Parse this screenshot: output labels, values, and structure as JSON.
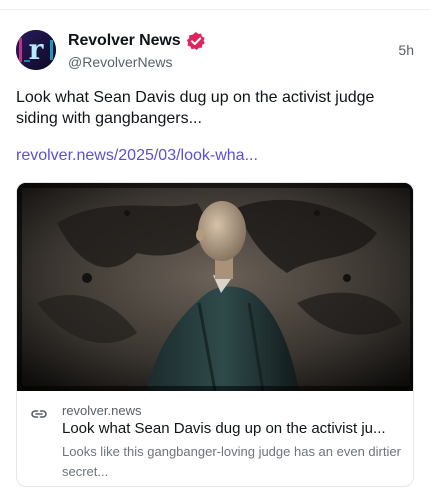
{
  "author": {
    "display_name": "Revolver News",
    "handle": "@RevolverNews",
    "avatar_letter": "r",
    "verified_icon": "verified-badge-icon",
    "verified_color": "#e0245e"
  },
  "post": {
    "timestamp": "5h",
    "text": "Look what Sean Davis dug up on the activist judge siding with gangbangers...",
    "link_text": "revolver.news/2025/03/look-wha...",
    "link_color": "#5b4fd6"
  },
  "link_card": {
    "image_alt": "Judge in robe, side profile",
    "link_icon": "link-icon",
    "domain": "revolver.news",
    "title": "Look what Sean Davis dug up on the activist ju...",
    "description": "Looks like this gangbanger-loving judge has an even dirtier secret..."
  }
}
